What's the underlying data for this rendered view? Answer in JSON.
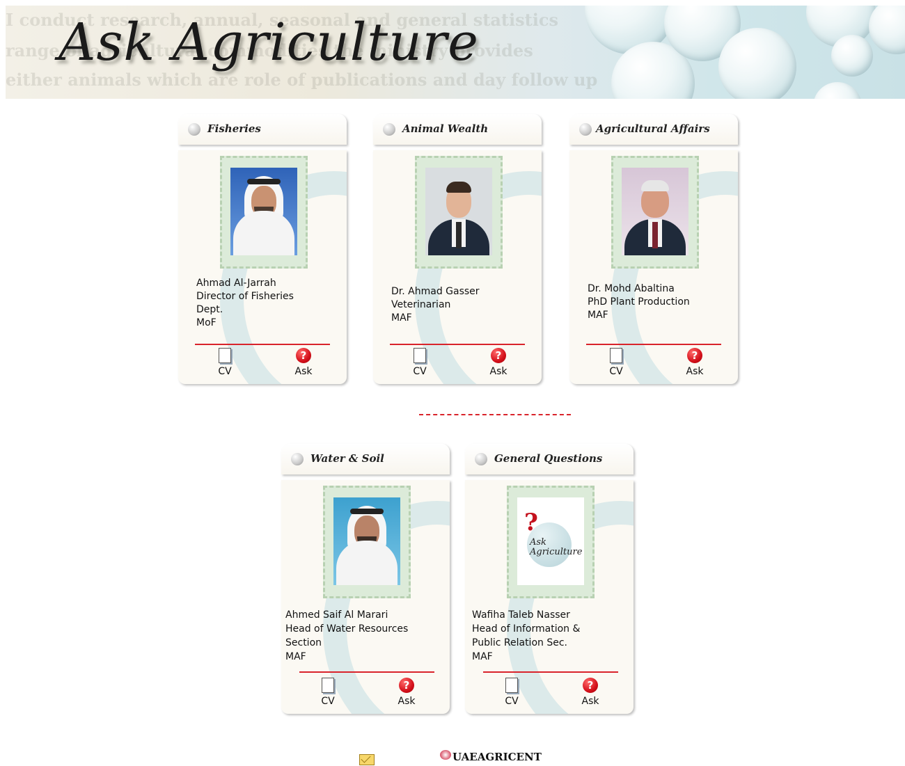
{
  "banner": {
    "title": "Ask Agriculture"
  },
  "cards": [
    {
      "category": "Fisheries",
      "lines": [
        "Ahmad Al-Jarrah",
        "Director of Fisheries",
        "Dept.",
        "MoF"
      ],
      "cv_label": "CV",
      "ask_label": "Ask"
    },
    {
      "category": "Animal Wealth",
      "lines": [
        "Dr. Ahmad Gasser",
        "Veterinarian",
        "MAF"
      ],
      "cv_label": "CV",
      "ask_label": "Ask"
    },
    {
      "category": "Agricultural Affairs",
      "lines": [
        "Dr. Mohd Abaltina",
        "PhD Plant Production",
        "MAF"
      ],
      "cv_label": "CV",
      "ask_label": "Ask"
    },
    {
      "category": "Water & Soil",
      "lines": [
        "Ahmed Saif Al Marari",
        "Head of Water Resources",
        "Section",
        "MAF"
      ],
      "cv_label": "CV",
      "ask_label": "Ask"
    },
    {
      "category": "General Questions",
      "lines": [
        "Wafiha Taleb Nasser",
        "Head of Information &",
        "Public Relation Sec.",
        "MAF"
      ],
      "cv_label": "CV",
      "ask_label": "Ask",
      "logo_text": "Ask Agriculture"
    }
  ],
  "footer": {
    "brand": "UAEAGRICENT"
  },
  "icons": {
    "cv": "document-icon",
    "ask": "question-icon",
    "mail": "mail-icon",
    "header_ball": "sphere-bullet-icon"
  },
  "colors": {
    "accent_red": "#d9232b",
    "card_bg": "#fbf9f3",
    "swirl": "#c3dee2"
  }
}
